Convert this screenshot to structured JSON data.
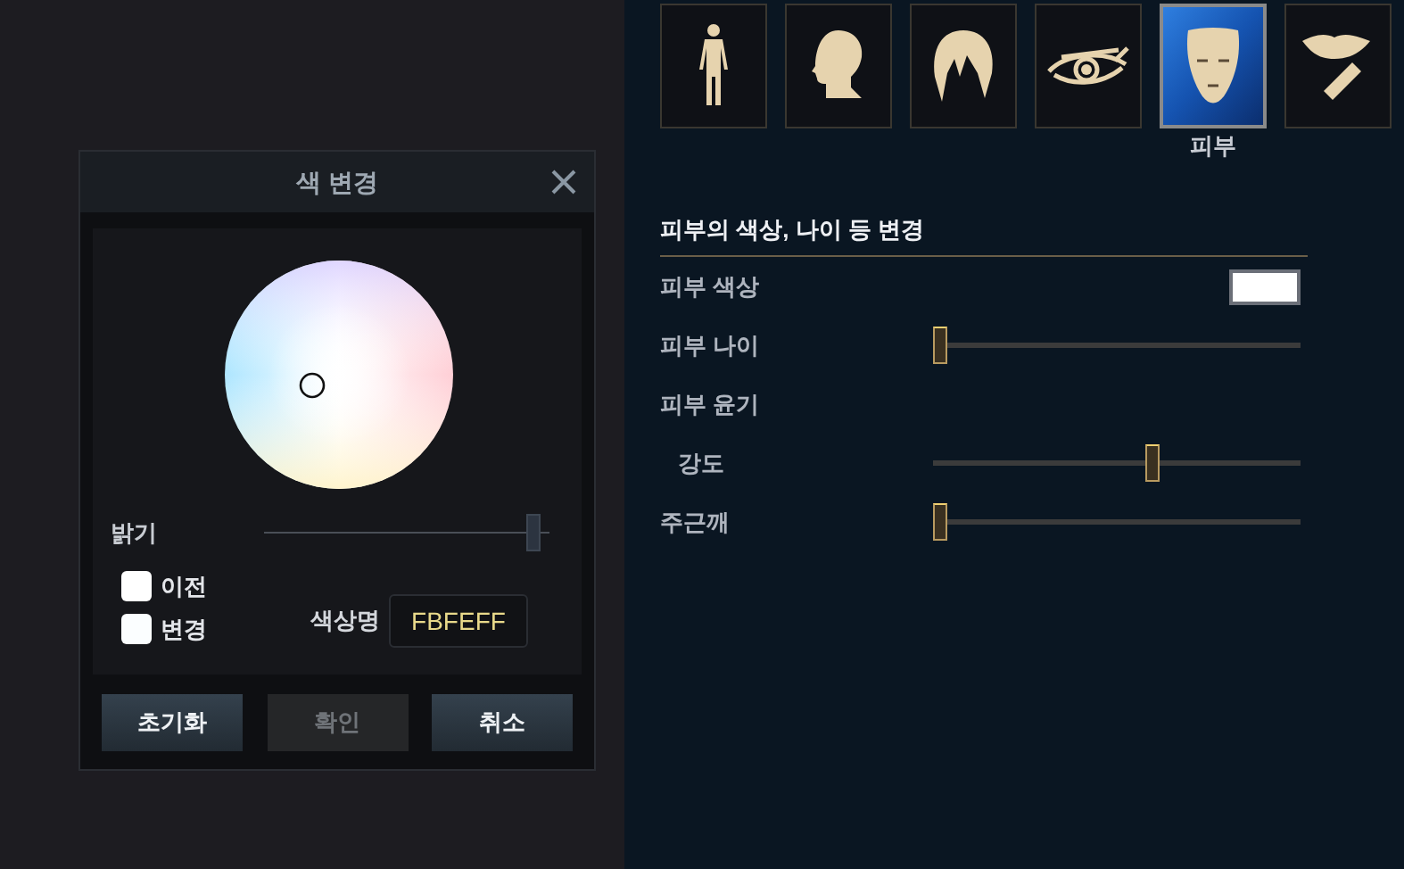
{
  "tabs": [
    {
      "kind": "body",
      "selected": false
    },
    {
      "kind": "head",
      "selected": false
    },
    {
      "kind": "hair",
      "selected": false
    },
    {
      "kind": "eye",
      "selected": false
    },
    {
      "kind": "face",
      "selected": true,
      "label": "피부"
    },
    {
      "kind": "lips",
      "selected": false
    }
  ],
  "dialog": {
    "title": "색 변경",
    "brightness": {
      "label": "밝기",
      "level": 0.97
    },
    "swatches": [
      {
        "label": "이전",
        "color": "#ffffff"
      },
      {
        "label": "변경",
        "color": "#fbfeff"
      }
    ],
    "color_name": {
      "label": "색상명",
      "value": "FBFEFF"
    },
    "buttons": [
      {
        "label": "초기화",
        "disabled": false
      },
      {
        "label": "확인",
        "disabled": true
      },
      {
        "label": "취소",
        "disabled": false
      }
    ]
  },
  "section": {
    "title": "피부의 색상, 나이 등 변경",
    "rows": [
      {
        "kind": "color",
        "label": "피부 색상",
        "color": "#ffffff"
      },
      {
        "kind": "slider",
        "label": "피부 나이",
        "level": 0
      },
      {
        "kind": "heading",
        "label": "피부 윤기"
      },
      {
        "kind": "subslider",
        "label": "강도",
        "level": 0.6
      },
      {
        "kind": "slider",
        "label": "주근깨",
        "level": 0
      }
    ]
  }
}
